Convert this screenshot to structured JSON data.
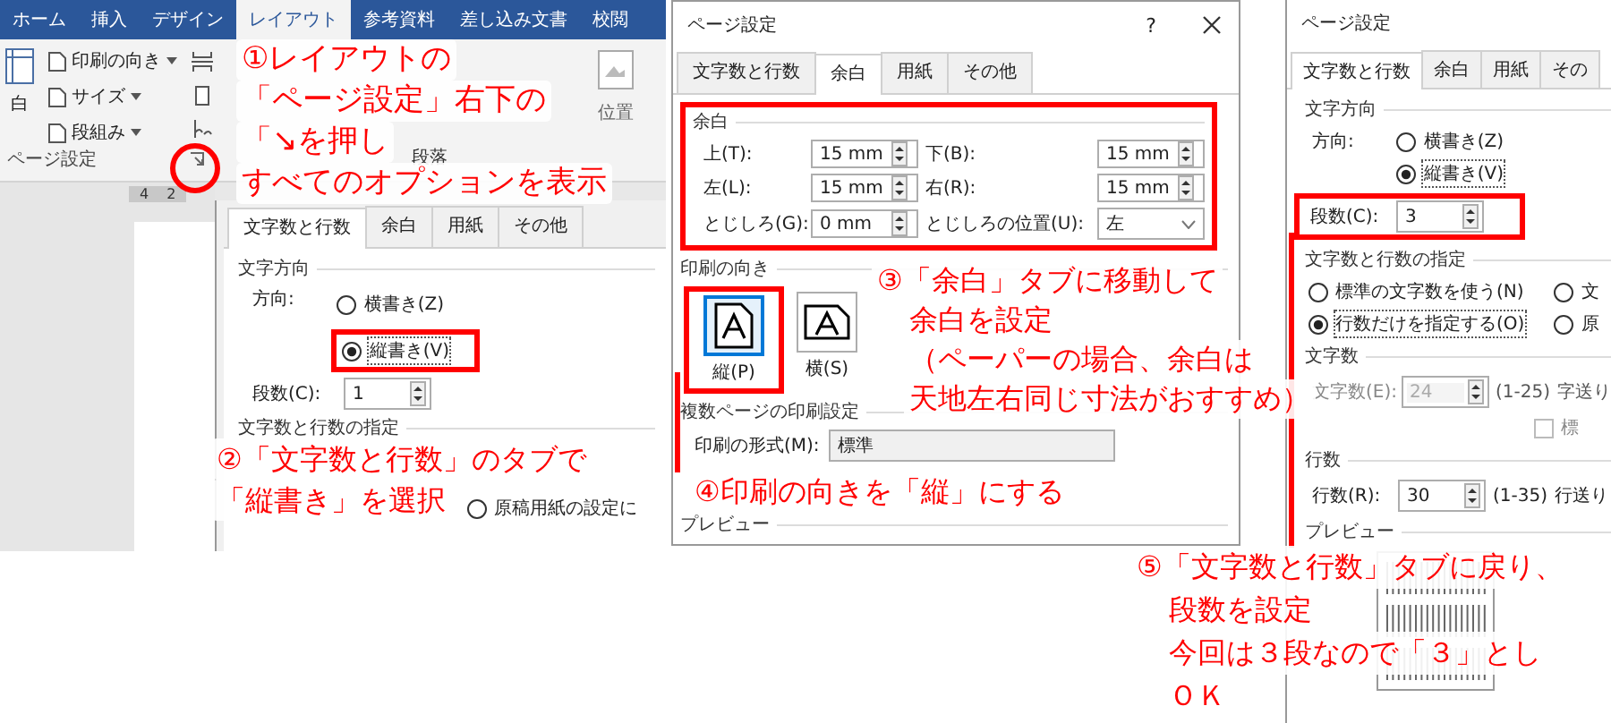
{
  "left_panel": {
    "ribbon_tabs": [
      {
        "label": "ホーム",
        "selected": false
      },
      {
        "label": "挿入",
        "selected": false
      },
      {
        "label": "デザイン",
        "selected": false
      },
      {
        "label": "レイアウト",
        "selected": true
      },
      {
        "label": "参考資料",
        "selected": false
      },
      {
        "label": "差し込み文書",
        "selected": false
      },
      {
        "label": "校閲",
        "selected": false
      }
    ],
    "margin_button_fragment": "白",
    "ribbon_buttons": [
      {
        "label": "印刷の向き"
      },
      {
        "label": "サイズ"
      },
      {
        "label": "段組み"
      }
    ],
    "group_label": "ページ設定",
    "paragraph_group_label": "段落",
    "position_button": "位置",
    "ruler": [
      "4",
      "2"
    ],
    "dialog": {
      "tabs": [
        {
          "label": "文字数と行数",
          "selected": true
        },
        {
          "label": "余白",
          "selected": false
        },
        {
          "label": "用紙",
          "selected": false
        },
        {
          "label": "その他",
          "selected": false
        }
      ],
      "direction_section": "文字方向",
      "direction_label": "方向:",
      "direction_options": [
        {
          "label": "横書き(Z)",
          "selected": false
        },
        {
          "label": "縦書き(V)",
          "selected": true
        }
      ],
      "columns_label": "段数(C):",
      "columns_value": "1",
      "grid_section": "文字数と行数の指定",
      "grid_option": {
        "label": "原稿用紙の設定に",
        "selected": false
      }
    }
  },
  "margins_dialog": {
    "title": "ページ設定",
    "help": "?",
    "tabs": [
      {
        "label": "文字数と行数",
        "selected": false
      },
      {
        "label": "余白",
        "selected": true
      },
      {
        "label": "用紙",
        "selected": false
      },
      {
        "label": "その他",
        "selected": false
      }
    ],
    "margins_section": "余白",
    "fields": [
      {
        "label": "上(T):",
        "value": "15 mm"
      },
      {
        "label": "下(B):",
        "value": "15 mm"
      },
      {
        "label": "左(L):",
        "value": "15 mm"
      },
      {
        "label": "右(R):",
        "value": "15 mm"
      },
      {
        "label": "とじしろ(G):",
        "value": "0 mm"
      }
    ],
    "gutter_position": {
      "label": "とじしろの位置(U):",
      "value": "左"
    },
    "orientation_section": "印刷の向き",
    "orientations": [
      {
        "label": "縦(P)",
        "selected": true
      },
      {
        "label": "横(S)",
        "selected": false
      }
    ],
    "pages_section": "複数ページの印刷設定",
    "print_format": {
      "label": "印刷の形式(M):",
      "value": "標準"
    },
    "preview_section": "プレビュー"
  },
  "columns_dialog": {
    "title": "ページ設定",
    "tabs": [
      {
        "label": "文字数と行数",
        "selected": true
      },
      {
        "label": "余白",
        "selected": false
      },
      {
        "label": "用紙",
        "selected": false
      },
      {
        "label": "その",
        "selected": false
      }
    ],
    "direction_section": "文字方向",
    "direction_label": "方向:",
    "direction_options": [
      {
        "label": "横書き(Z)",
        "selected": false
      },
      {
        "label": "縦書き(V)",
        "selected": true
      }
    ],
    "columns_label": "段数(C):",
    "columns_value": "3",
    "grid_section": "文字数と行数の指定",
    "grid_options": [
      {
        "label": "標準の文字数を使う(N)",
        "selected": false
      },
      {
        "label": "文",
        "selected": false
      },
      {
        "label": "行数だけを指定する(O)",
        "selected": true
      },
      {
        "label": "原",
        "selected": false
      }
    ],
    "chars_section": "文字数",
    "chars_label": "文字数(E):",
    "chars_value": "24",
    "chars_range": "(1-25)",
    "chars_pitch": "字送り",
    "chars_disabled": true,
    "standard_checkbox": {
      "label": "標",
      "checked": false
    },
    "lines_section": "行数",
    "lines_label": "行数(R):",
    "lines_value": "30",
    "lines_range": "(1-35)",
    "lines_pitch": "行送り",
    "preview_section": "プレビュー"
  },
  "callouts": [
    {
      "lines": [
        "①レイアウトの",
        "「ページ設定」右下の",
        "「↘を押し",
        "すべてのオプションを表示"
      ]
    },
    {
      "lines": [
        "②「文字数と行数」のタブで",
        "「縦書き」を選択"
      ]
    },
    {
      "lines": [
        "③「余白」タブに移動して",
        "余白を設定",
        "（ペーパーの場合、余白は",
        "天地左右同じ寸法がおすすめ）"
      ]
    },
    {
      "lines": [
        "④印刷の向きを「縦」にする"
      ]
    },
    {
      "lines": [
        "⑤「文字数と行数」タブに戻り、",
        "段数を設定",
        "今回は３段なので「３」とし",
        "ＯＫ"
      ]
    }
  ]
}
